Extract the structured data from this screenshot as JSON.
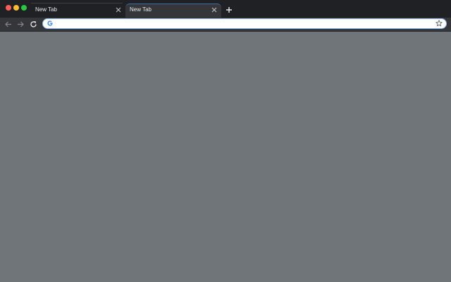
{
  "window": {
    "traffic_lights": {
      "close_color": "#ff5f57",
      "minimize_color": "#febc2e",
      "maximize_color": "#28c840"
    }
  },
  "tabs": [
    {
      "title": "New Tab",
      "active": false,
      "close_icon": "close-icon"
    },
    {
      "title": "New Tab",
      "active": true,
      "close_icon": "close-icon"
    }
  ],
  "new_tab_icon": "plus-icon",
  "toolbar": {
    "back_icon": "arrow-left-icon",
    "forward_icon": "arrow-right-icon",
    "reload_icon": "reload-icon"
  },
  "omnibox": {
    "value": "",
    "placeholder": "",
    "leading_icon": "google-g-icon",
    "trailing_icon": "star-icon",
    "focus_color": "#8ab4f8"
  },
  "content": {
    "background_color": "#70757a"
  }
}
